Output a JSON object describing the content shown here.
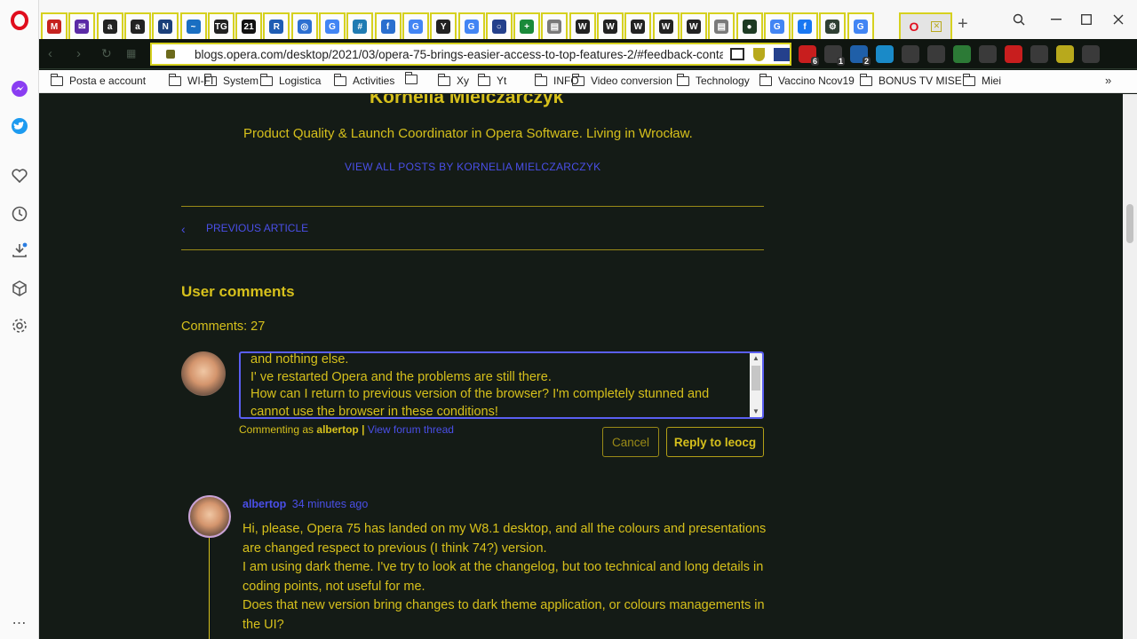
{
  "browser": {
    "tabs": [
      {
        "icon": "gmail-icon",
        "letter": "M",
        "color": "#c5221f"
      },
      {
        "icon": "mail-icon",
        "letter": "✉",
        "color": "#5b2aa6"
      },
      {
        "icon": "amazon-icon",
        "letter": "a",
        "color": "#222"
      },
      {
        "icon": "amazon-icon",
        "letter": "a",
        "color": "#222"
      },
      {
        "icon": "news-icon",
        "letter": "N",
        "color": "#1b3f7a"
      },
      {
        "icon": "wave-icon",
        "letter": "~",
        "color": "#1a6fc2"
      },
      {
        "icon": "tg-icon",
        "letter": "TG",
        "color": "#222"
      },
      {
        "icon": "num-21-icon",
        "letter": "21",
        "color": "#111"
      },
      {
        "icon": "r-icon",
        "letter": "R",
        "color": "#1e5cb3"
      },
      {
        "icon": "globe-icon",
        "letter": "◎",
        "color": "#2c6fd1"
      },
      {
        "icon": "google-icon",
        "letter": "G",
        "color": "#4285f4"
      },
      {
        "icon": "hash-icon",
        "letter": "#",
        "color": "#1f7bb3"
      },
      {
        "icon": "feed-icon",
        "letter": "f",
        "color": "#2a6fcf"
      },
      {
        "icon": "google-icon",
        "letter": "G",
        "color": "#4285f4"
      },
      {
        "icon": "y-icon",
        "letter": "Y",
        "color": "#222"
      },
      {
        "icon": "google-icon",
        "letter": "G",
        "color": "#4285f4"
      },
      {
        "icon": "circle-icon",
        "letter": "○",
        "color": "#24408c"
      },
      {
        "icon": "plus-icon",
        "letter": "+",
        "color": "#1a8a3a"
      },
      {
        "icon": "doc-icon",
        "letter": "▤",
        "color": "#7a7a7a"
      },
      {
        "icon": "wikipedia-icon",
        "letter": "W",
        "color": "#222"
      },
      {
        "icon": "wikipedia-icon",
        "letter": "W",
        "color": "#222"
      },
      {
        "icon": "wikipedia-icon",
        "letter": "W",
        "color": "#222"
      },
      {
        "icon": "wikipedia-icon",
        "letter": "W",
        "color": "#222"
      },
      {
        "icon": "wikipedia-icon",
        "letter": "W",
        "color": "#222"
      },
      {
        "icon": "doc-icon",
        "letter": "▤",
        "color": "#7a7a7a"
      },
      {
        "icon": "dark-circle-icon",
        "letter": "●",
        "color": "#1e3b24"
      },
      {
        "icon": "google-icon",
        "letter": "G",
        "color": "#4285f4"
      },
      {
        "icon": "facebook-icon",
        "letter": "f",
        "color": "#1877f2"
      },
      {
        "icon": "gear-icon",
        "letter": "⚙",
        "color": "#2f3f33"
      },
      {
        "icon": "google-icon",
        "letter": "G",
        "color": "#4285f4"
      }
    ],
    "active_tab": {
      "icon": "opera-icon",
      "label": "O"
    },
    "new_tab": "+",
    "url": "blogs.opera.com/desktop/2021/03/opera-75-brings-easier-access-to-top-features-2/#feedback-conta",
    "extensions": [
      {
        "icon": "abp-icon",
        "badge": "6"
      },
      {
        "icon": "cloud-icon",
        "badge": "1"
      },
      {
        "icon": "puzzle-icon",
        "badge": "2"
      },
      {
        "icon": "code-icon",
        "badge": ""
      },
      {
        "icon": "mouse-icon",
        "badge": ""
      },
      {
        "icon": "crosshair-icon",
        "badge": ""
      },
      {
        "icon": "cube-icon",
        "badge": ""
      },
      {
        "icon": "trash-icon",
        "badge": ""
      },
      {
        "icon": "download-icon",
        "badge": ""
      },
      {
        "icon": "box-icon",
        "badge": ""
      },
      {
        "icon": "battery-icon",
        "badge": ""
      },
      {
        "icon": "menu-icon",
        "badge": ""
      }
    ],
    "bookmarks": [
      "Posta e account",
      "WI-FI",
      "System",
      "Logistica",
      "Activities",
      "",
      "Xy",
      "Yt",
      "INFO",
      "Video conversion",
      "Technology",
      "Vaccino Ncov19",
      "BONUS TV MISE",
      "Miei"
    ]
  },
  "author": {
    "name": "Kornelia Mielczarczyk",
    "bio": "Product Quality & Launch Coordinator in Opera Software. Living in Wrocław.",
    "view_all": "VIEW ALL POSTS BY KORNELIA MIELCZARCZYK"
  },
  "nav": {
    "previous": "PREVIOUS ARTICLE"
  },
  "comments": {
    "heading": "User comments",
    "count_label": "Comments: 27",
    "reply_text_lines": [
      "and nothing else.",
      "I' ve restarted Opera and the problems are still there.",
      "How can I return to previous version of the browser? I'm completely stunned and",
      "cannot use the browser in these conditions!"
    ],
    "commenting_as": "Commenting as",
    "username": "albertop",
    "separator": "|",
    "view_forum": "View forum thread",
    "cancel": "Cancel",
    "reply_button": "Reply to leocg",
    "first_comment": {
      "author": "albertop",
      "time": "34 minutes ago",
      "lines": [
        "Hi, please, Opera 75 has landed on my W8.1 desktop, and all the colours and presentations",
        "are changed respect to previous (I think 74?) version.",
        "I am using dark theme. I've try to look at the changelog, but too technical and long details in",
        "coding points, not useful for me.",
        "Does that new version bring changes to dark theme application, or colours managements in",
        "the UI?"
      ]
    }
  },
  "colors": {
    "accent": "#d6c01c",
    "link": "#4a4fe8",
    "background": "#141b16",
    "tab_border": "#d6d11f"
  }
}
